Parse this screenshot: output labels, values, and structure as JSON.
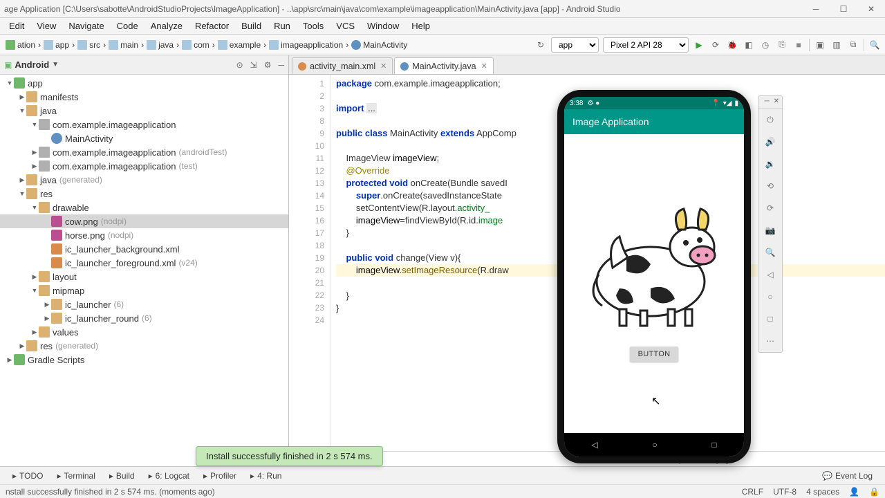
{
  "window": {
    "title": "age Application [C:\\Users\\sabotte\\AndroidStudioProjects\\ImageApplication] - ..\\app\\src\\main\\java\\com\\example\\imageapplication\\MainActivity.java [app] - Android Studio"
  },
  "menu": [
    "Edit",
    "View",
    "Navigate",
    "Code",
    "Analyze",
    "Refactor",
    "Build",
    "Run",
    "Tools",
    "VCS",
    "Window",
    "Help"
  ],
  "breadcrumbs": [
    "ation",
    "app",
    "src",
    "main",
    "java",
    "com",
    "example",
    "imageapplication",
    "MainActivity"
  ],
  "run_config": {
    "module": "app",
    "device": "Pixel 2 API 28"
  },
  "project_panel": {
    "selector": "Android",
    "tree": [
      {
        "depth": 0,
        "icon": "mod",
        "label": "app",
        "expanded": true
      },
      {
        "depth": 1,
        "icon": "folder",
        "label": "manifests",
        "expanded": false
      },
      {
        "depth": 1,
        "icon": "folder",
        "label": "java",
        "expanded": true
      },
      {
        "depth": 2,
        "icon": "pkg",
        "label": "com.example.imageapplication",
        "expanded": true
      },
      {
        "depth": 3,
        "icon": "class",
        "label": "MainActivity",
        "leaf": true
      },
      {
        "depth": 2,
        "icon": "pkg",
        "label": "com.example.imageapplication",
        "suffix": "(androidTest)",
        "expanded": false
      },
      {
        "depth": 2,
        "icon": "pkg",
        "label": "com.example.imageapplication",
        "suffix": "(test)",
        "expanded": false
      },
      {
        "depth": 1,
        "icon": "folder",
        "label": "java",
        "suffix": "(generated)",
        "expanded": false
      },
      {
        "depth": 1,
        "icon": "folder",
        "label": "res",
        "expanded": true
      },
      {
        "depth": 2,
        "icon": "folder",
        "label": "drawable",
        "expanded": true
      },
      {
        "depth": 3,
        "icon": "img",
        "label": "cow.png",
        "suffix": "(nodpi)",
        "leaf": true,
        "sel": true
      },
      {
        "depth": 3,
        "icon": "img",
        "label": "horse.png",
        "suffix": "(nodpi)",
        "leaf": true
      },
      {
        "depth": 3,
        "icon": "xml",
        "label": "ic_launcher_background.xml",
        "leaf": true
      },
      {
        "depth": 3,
        "icon": "xml",
        "label": "ic_launcher_foreground.xml",
        "suffix": "(v24)",
        "leaf": true
      },
      {
        "depth": 2,
        "icon": "folder",
        "label": "layout",
        "expanded": false
      },
      {
        "depth": 2,
        "icon": "folder",
        "label": "mipmap",
        "expanded": true
      },
      {
        "depth": 3,
        "icon": "folder",
        "label": "ic_launcher",
        "suffix": "(6)",
        "expanded": false
      },
      {
        "depth": 3,
        "icon": "folder",
        "label": "ic_launcher_round",
        "suffix": "(6)",
        "expanded": false
      },
      {
        "depth": 2,
        "icon": "folder",
        "label": "values",
        "expanded": false
      },
      {
        "depth": 1,
        "icon": "folder",
        "label": "res",
        "suffix": "(generated)",
        "expanded": false
      },
      {
        "depth": 0,
        "icon": "mod",
        "label": "Gradle Scripts",
        "expanded": false
      }
    ]
  },
  "editor": {
    "tabs": [
      {
        "label": "activity_main.xml",
        "kind": "xml",
        "active": false
      },
      {
        "label": "MainActivity.java",
        "kind": "java",
        "active": true
      }
    ],
    "crumb": [
      "ctivity",
      "change()"
    ],
    "lines": [
      {
        "n": 1,
        "html": "<span class='kw'>package</span> com.example.imageapplication;"
      },
      {
        "n": 2,
        "html": ""
      },
      {
        "n": 3,
        "html": "<span class='kw'>import</span> <span class='import-hl'>...</span>"
      },
      {
        "n": 8,
        "html": ""
      },
      {
        "n": 9,
        "html": "<span class='kw'>public class</span> MainActivity <span class='kw'>extends</span> AppComp",
        "mark": true
      },
      {
        "n": 10,
        "html": ""
      },
      {
        "n": 11,
        "html": "    ImageView <span class='cls'>imageView</span>;"
      },
      {
        "n": 12,
        "html": "    <span class='ann'>@Override</span>"
      },
      {
        "n": 13,
        "html": "    <span class='kw'>protected void</span> onCreate(Bundle savedI",
        "mark": true
      },
      {
        "n": 14,
        "html": "        <span class='kw'>super</span>.onCreate(savedInstanceState"
      },
      {
        "n": 15,
        "html": "        setContentView(R.layout.<span class='str'>activity_</span>"
      },
      {
        "n": 16,
        "html": "        <span class='cls'>imageView</span>=findViewById(R.id.<span class='str'>image</span>"
      },
      {
        "n": 17,
        "html": "    }"
      },
      {
        "n": 18,
        "html": ""
      },
      {
        "n": 19,
        "html": "    <span class='kw'>public void</span> change(View v){"
      },
      {
        "n": 20,
        "html": "        <span class='cls'>imageView</span>.<span class='fn'>setImageResource</span>(R.draw",
        "cur": true
      },
      {
        "n": 21,
        "html": ""
      },
      {
        "n": 22,
        "html": "    }"
      },
      {
        "n": 23,
        "html": "}"
      },
      {
        "n": 24,
        "html": ""
      }
    ]
  },
  "emulator": {
    "status_time": "3:38",
    "app_title": "Image Application",
    "button_label": "BUTTON"
  },
  "bottom_tabs": [
    "TODO",
    "Terminal",
    "Build",
    "6: Logcat",
    "Profiler",
    "4: Run"
  ],
  "bottom_right": "Event Log",
  "status": {
    "msg": "nstall successfully finished in 2 s 574 ms. (moments ago)",
    "crlf": "CRLF",
    "enc": "UTF-8",
    "indent": "4 spaces"
  },
  "toast": "Install successfully finished in 2 s 574 ms."
}
